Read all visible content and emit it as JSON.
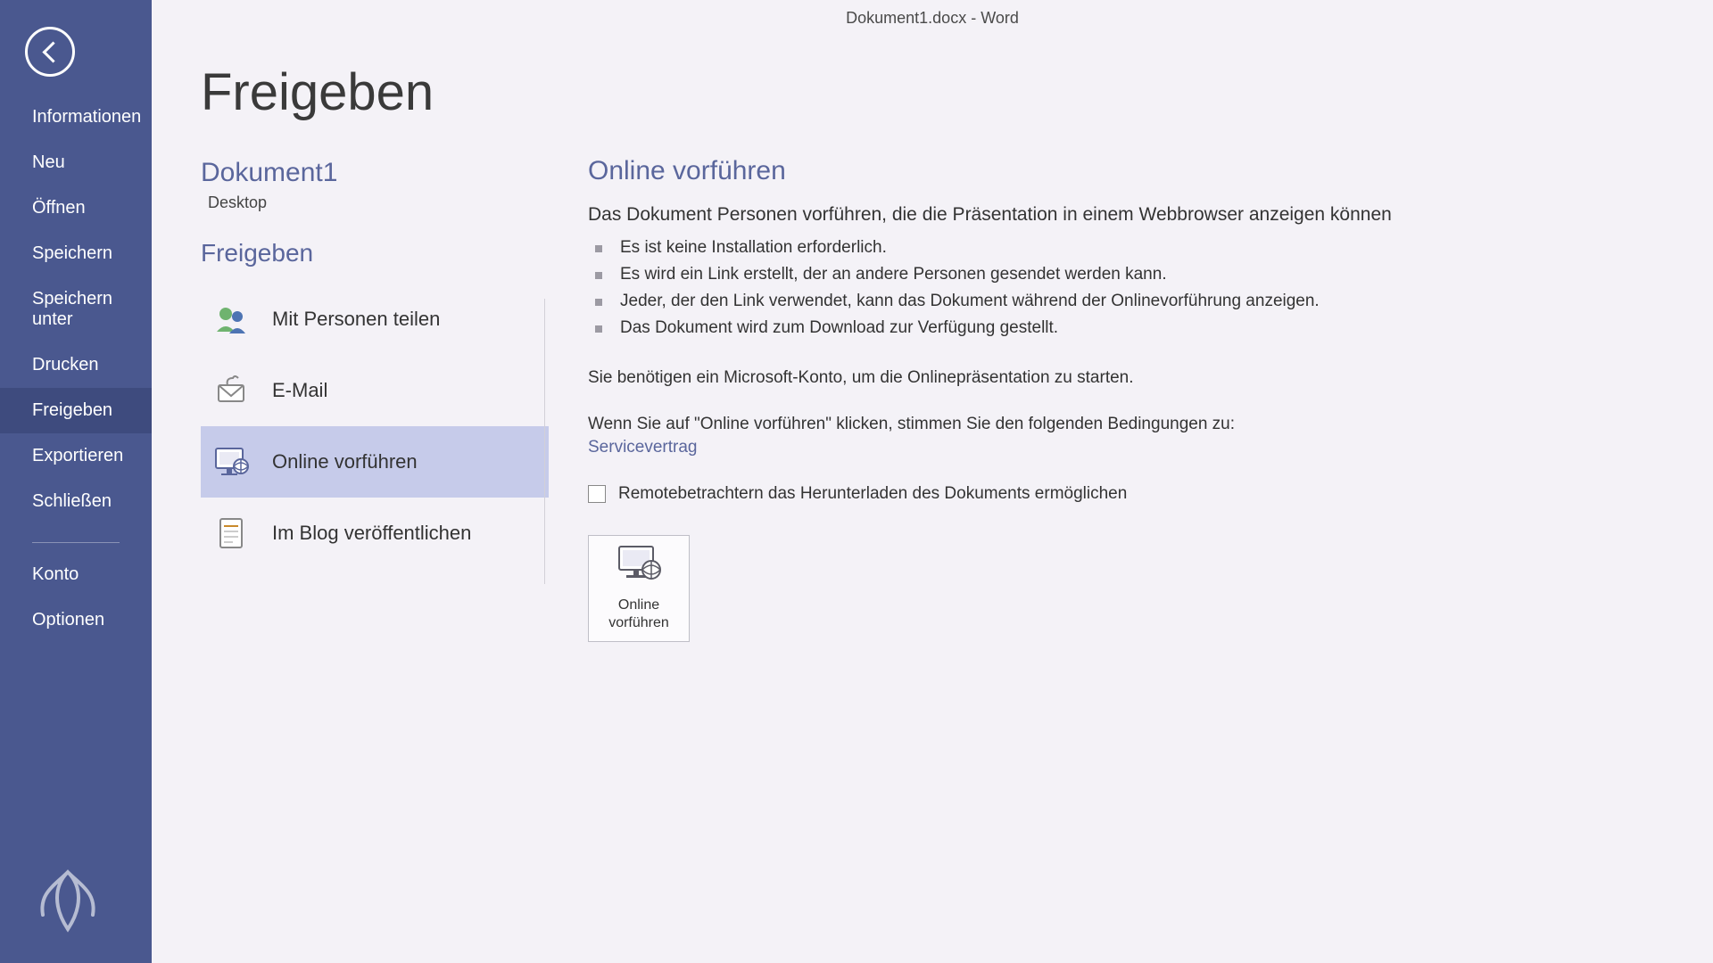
{
  "window_title": "Dokument1.docx - Word",
  "page_title": "Freigeben",
  "nav": {
    "items": [
      "Informationen",
      "Neu",
      "Öffnen",
      "Speichern",
      "Speichern unter",
      "Drucken",
      "Freigeben",
      "Exportieren",
      "Schließen"
    ],
    "footer": [
      "Konto",
      "Optionen"
    ],
    "active_index": 6
  },
  "doc": {
    "name": "Dokument1",
    "location": "Desktop"
  },
  "share": {
    "heading": "Freigeben",
    "options": [
      {
        "label": "Mit Personen teilen"
      },
      {
        "label": "E-Mail"
      },
      {
        "label": "Online vorführen"
      },
      {
        "label": "Im Blog veröffentlichen"
      }
    ],
    "selected_index": 2
  },
  "detail": {
    "title": "Online vorführen",
    "lead": "Das Dokument Personen vorführen, die die Präsentation in einem Webbrowser anzeigen können",
    "bullets": [
      "Es ist keine Installation erforderlich.",
      "Es wird ein Link erstellt, der an andere Personen gesendet werden kann.",
      "Jeder, der den Link verwendet, kann das Dokument während der Onlinevorführung anzeigen.",
      "Das Dokument wird zum Download zur Verfügung gestellt."
    ],
    "need_account": "Sie benötigen ein Microsoft-Konto, um die Onlinepräsentation zu starten.",
    "agree_text": "Wenn Sie auf \"Online vorführen\" klicken, stimmen Sie den folgenden Bedingungen zu:",
    "service_link": "Servicevertrag",
    "checkbox_label": "Remotebetrachtern das Herunterladen des Dokuments ermöglichen",
    "button_line1": "Online",
    "button_line2": "vorführen"
  }
}
